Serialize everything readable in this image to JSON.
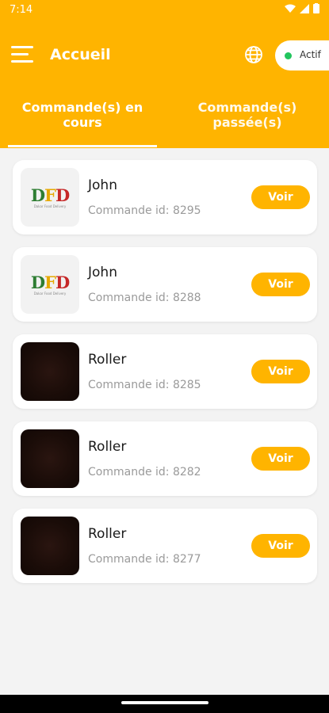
{
  "status_bar": {
    "time": "7:14"
  },
  "header": {
    "title": "Accueil",
    "status_label": "Actif",
    "status_color": "#22c55e"
  },
  "tabs": [
    {
      "label_line1": "Commande(s) en",
      "label_line2": "cours",
      "selected": true
    },
    {
      "label_line1": "Commande(s)",
      "label_line2": "passée(s)",
      "selected": false
    }
  ],
  "orders": [
    {
      "name": "John",
      "order_text": "Commande id: 8295",
      "thumbnail": "dfd-logo",
      "button": "Voir"
    },
    {
      "name": "John",
      "order_text": "Commande id: 8288",
      "thumbnail": "dfd-logo",
      "button": "Voir"
    },
    {
      "name": "Roller",
      "order_text": "Commande id: 8285",
      "thumbnail": "dark-photo",
      "button": "Voir"
    },
    {
      "name": "Roller",
      "order_text": "Commande id: 8282",
      "thumbnail": "dark-photo",
      "button": "Voir"
    },
    {
      "name": "Roller",
      "order_text": "Commande id: 8277",
      "thumbnail": "dark-photo",
      "button": "Voir"
    }
  ],
  "logo": {
    "letters": [
      "D",
      "F",
      "D"
    ],
    "subtitle": "Dakar Food Delivery"
  },
  "colors": {
    "accent": "#ffb400"
  }
}
